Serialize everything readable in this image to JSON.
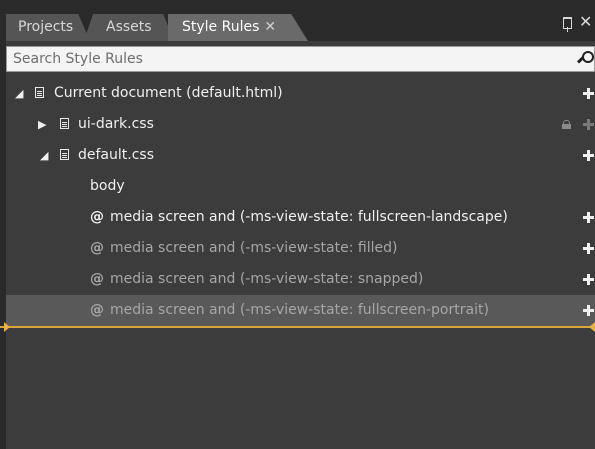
{
  "tabs": [
    {
      "label": "Projects"
    },
    {
      "label": "Assets"
    },
    {
      "label": "Style Rules",
      "close": "✕"
    }
  ],
  "panel_controls": {
    "pin": "pin-icon",
    "close": "✕"
  },
  "search": {
    "placeholder": "Search Style Rules",
    "value": ""
  },
  "tree": {
    "root": {
      "caret": "◢",
      "label": "Current document (default.html)"
    },
    "ui_dark": {
      "caret": "▶",
      "label": "ui-dark.css"
    },
    "default_css": {
      "caret": "◢",
      "label": "default.css"
    },
    "body": {
      "label": "body"
    },
    "media": [
      {
        "at": "@",
        "label": "media screen and (-ms-view-state: fullscreen-landscape)"
      },
      {
        "at": "@",
        "label": "media screen and (-ms-view-state: filled)"
      },
      {
        "at": "@",
        "label": "media screen and (-ms-view-state: snapped)"
      },
      {
        "at": "@",
        "label": "media screen and (-ms-view-state: fullscreen-portrait)"
      }
    ]
  },
  "colors": {
    "drop_indicator": "#d9a63a",
    "selected_row": "#595959",
    "tab_active": "#6a6a6a"
  }
}
